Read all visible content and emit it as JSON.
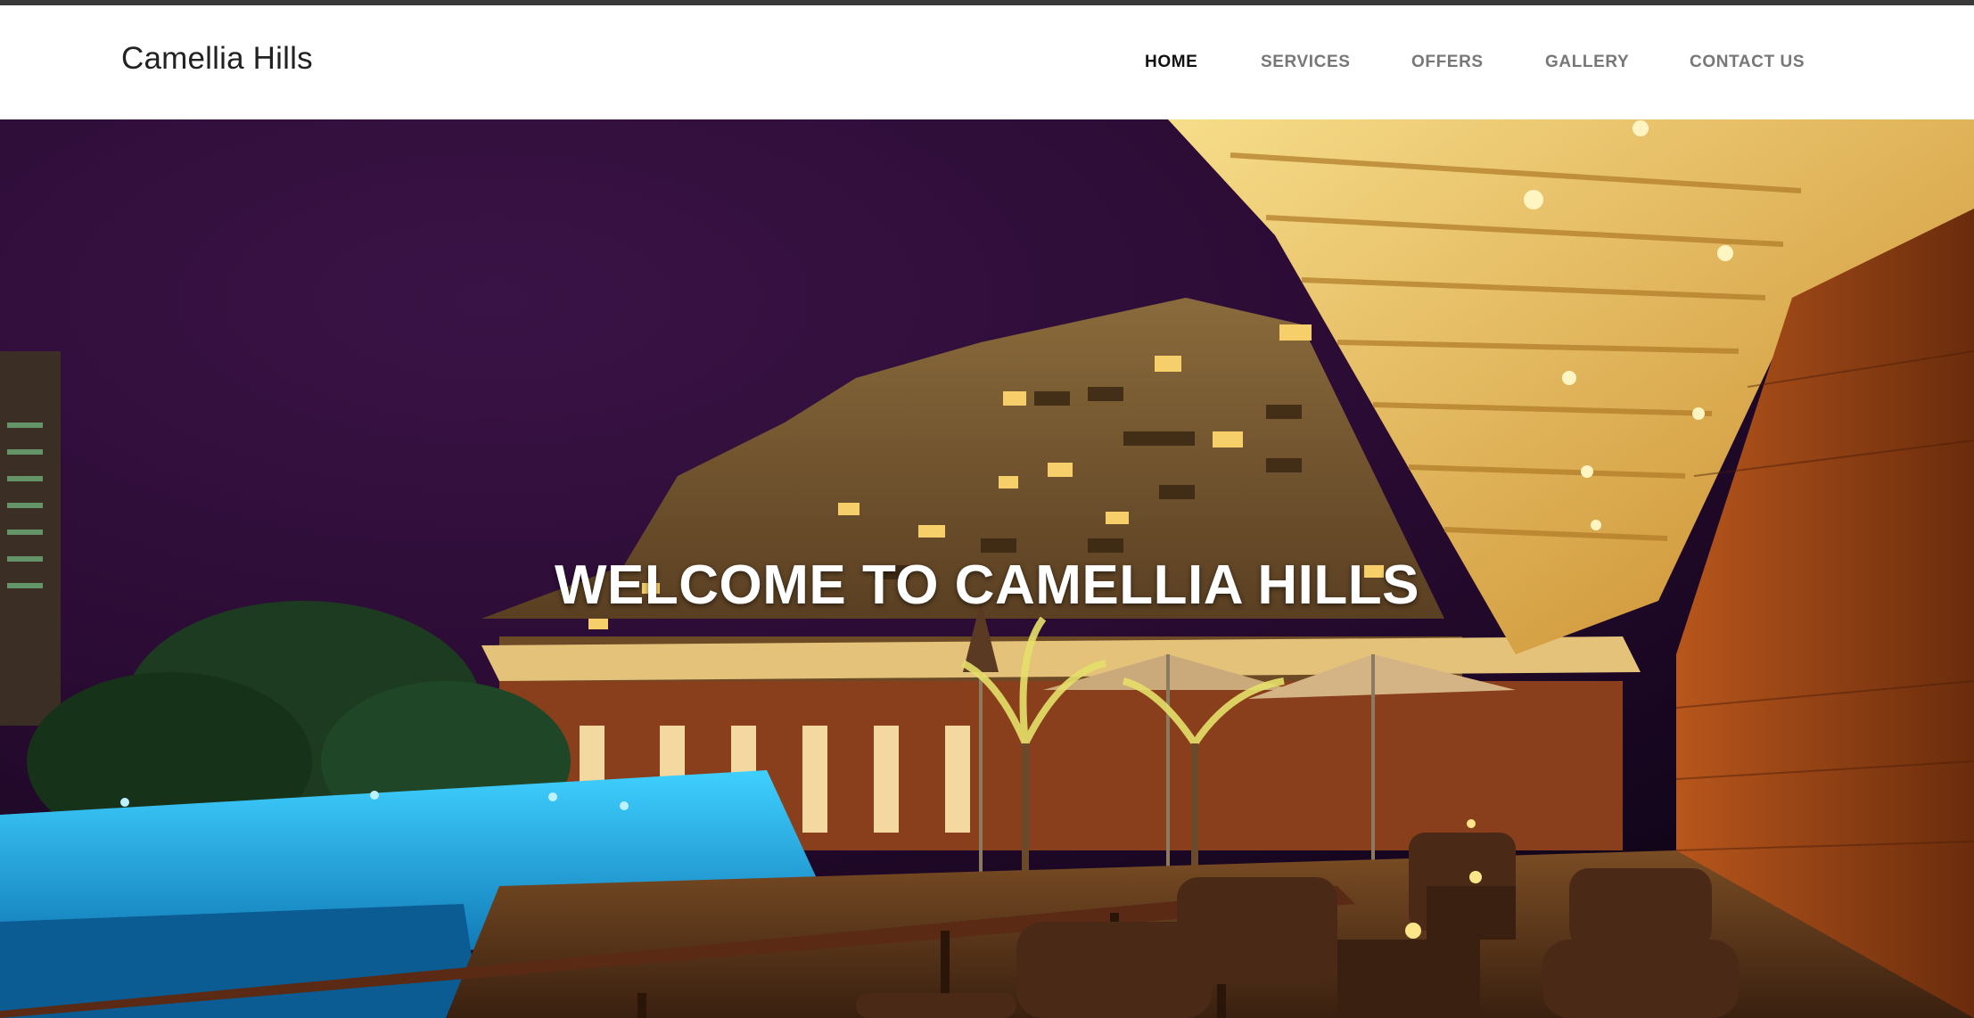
{
  "brand": {
    "name": "Camellia Hills"
  },
  "nav": {
    "items": [
      {
        "label": "HOME",
        "active": true
      },
      {
        "label": "SERVICES",
        "active": false
      },
      {
        "label": "OFFERS",
        "active": false
      },
      {
        "label": "GALLERY",
        "active": false
      },
      {
        "label": "CONTACT US",
        "active": false
      }
    ]
  },
  "hero": {
    "title": "WELCOME TO CAMELLIA HILLS",
    "image_description_icon": "hotel-night-pool-terrace-photo"
  },
  "colors": {
    "top_stripe": "#3a3a3a",
    "nav_active": "#111111",
    "nav_inactive": "#777777",
    "hero_sky": "#2a0b33",
    "pool": "#1aa7e0",
    "warm_light": "#f5b340"
  }
}
